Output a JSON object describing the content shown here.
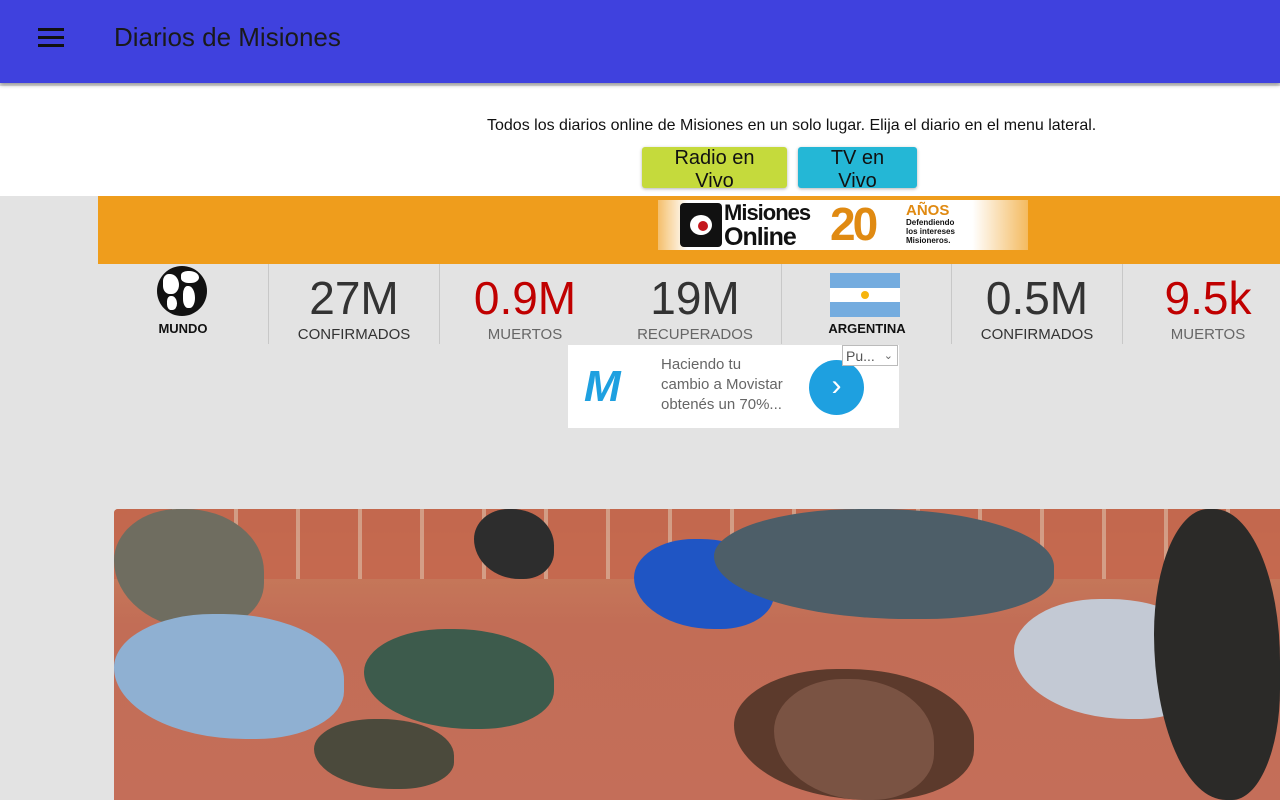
{
  "app_bar": {
    "title": "Diarios de Misiones",
    "menu_icon": "hamburger-menu-icon"
  },
  "intro": {
    "text": "Todos los diarios online de Misiones en un solo lugar. Elija el diario en el menu lateral.",
    "radio_button": "Radio en Vivo",
    "tv_button": "TV en Vivo"
  },
  "banner": {
    "logo_line1": "Misiones",
    "logo_line2": "Online",
    "anniversary_number": "20",
    "anniversary_word": "AÑOS",
    "tagline_1": "Defendiendo",
    "tagline_2": "los intereses",
    "tagline_3": "Misioneros.",
    "colors": {
      "banner_bg": "#ef9d1c"
    }
  },
  "stats": {
    "world": {
      "region": "MUNDO",
      "icon": "globe-icon",
      "confirmed": {
        "value": "27M",
        "label": "CONFIRMADOS"
      },
      "deaths": {
        "value": "0.9M",
        "label": "MUERTOS"
      },
      "recovered": {
        "value": "19M",
        "label": "RECUPERADOS"
      }
    },
    "country": {
      "region": "ARGENTINA",
      "icon": "argentina-flag-icon",
      "confirmed": {
        "value": "0.5M",
        "label": "CONFIRMADOS"
      },
      "deaths": {
        "value": "9.5k",
        "label": "MUERTOS"
      }
    },
    "colors": {
      "deaths": "#c00000",
      "text": "#333333"
    }
  },
  "ad": {
    "brand_icon": "movistar-m-icon",
    "text_line1": "Haciendo tu",
    "text_line2": "cambio a Movistar",
    "text_line3": "obtenés un 70%...",
    "select_value": "Pu...",
    "go_icon": "chevron-right-icon"
  },
  "colors": {
    "app_bar": "#3f41de",
    "radio_button": "#c5da3c",
    "tv_button": "#24b7d6",
    "page_bg": "#e3e3e3"
  }
}
